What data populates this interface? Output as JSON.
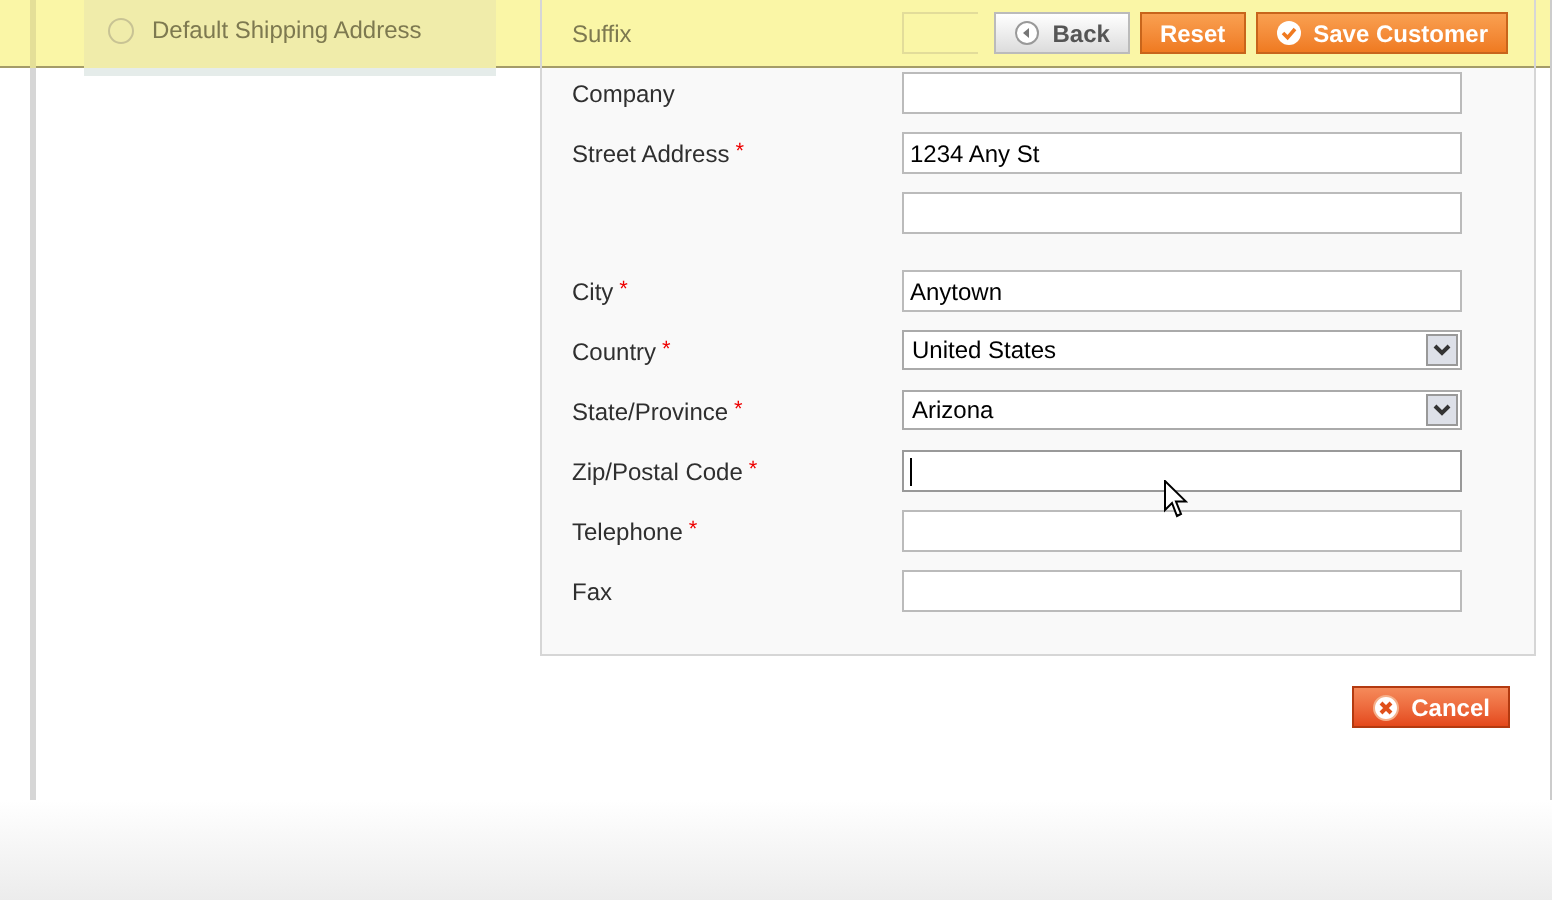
{
  "sidebar": {
    "radio_items": [
      {
        "label": "Default Shipping Address",
        "selected": false
      }
    ]
  },
  "toolbar": {
    "buttons": [
      {
        "label": "Back",
        "kind": "back"
      },
      {
        "label": "Reset",
        "kind": "plain"
      },
      {
        "label": "Save Customer",
        "kind": "save"
      }
    ]
  },
  "form": {
    "fields": [
      {
        "label": "Suffix",
        "kind": "text",
        "dimmed": true
      },
      {
        "label": "Company",
        "kind": "text"
      },
      {
        "label": "Street Address",
        "required_mark": "*",
        "kind": "text",
        "value": "1234 Any St"
      },
      {
        "kind": "text"
      },
      {
        "label": "City",
        "required_mark": "*",
        "kind": "text",
        "value": "Anytown"
      },
      {
        "label": "Country",
        "required_mark": "*",
        "kind": "select",
        "value": "United States"
      },
      {
        "label": "State/Province",
        "required_mark": "*",
        "kind": "select",
        "value": "Arizona"
      },
      {
        "label": "Zip/Postal Code",
        "required_mark": "*",
        "kind": "text",
        "focused": true
      },
      {
        "label": "Telephone",
        "required_mark": "*",
        "kind": "text"
      },
      {
        "label": "Fax",
        "kind": "text"
      }
    ]
  },
  "footer_buttons": [
    {
      "label": "Cancel",
      "kind": "cancel"
    }
  ]
}
